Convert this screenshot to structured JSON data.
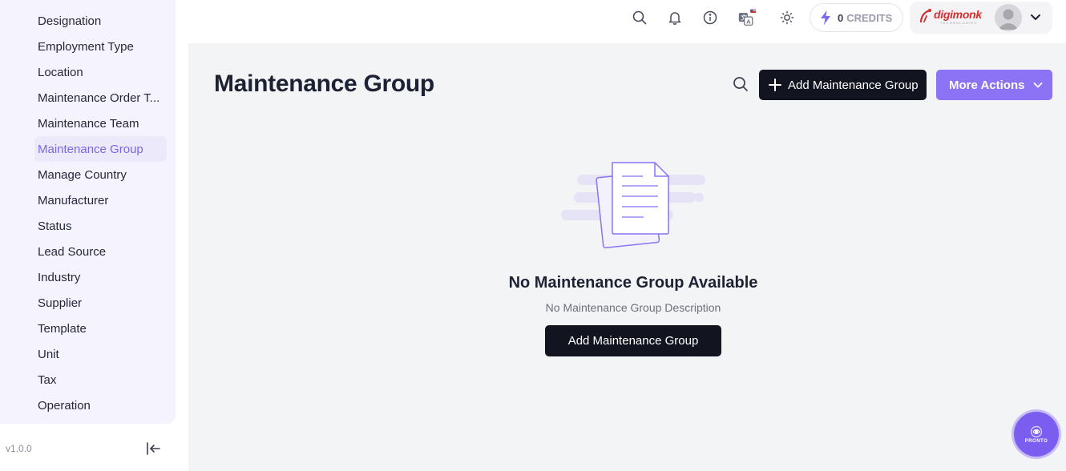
{
  "sidebar": {
    "items": [
      {
        "label": "Designation",
        "active": false
      },
      {
        "label": "Employment Type",
        "active": false
      },
      {
        "label": "Location",
        "active": false
      },
      {
        "label": "Maintenance Order T...",
        "active": false
      },
      {
        "label": "Maintenance Team",
        "active": false
      },
      {
        "label": "Maintenance Group",
        "active": true
      },
      {
        "label": "Manage Country",
        "active": false
      },
      {
        "label": "Manufacturer",
        "active": false
      },
      {
        "label": "Status",
        "active": false
      },
      {
        "label": "Lead Source",
        "active": false
      },
      {
        "label": "Industry",
        "active": false
      },
      {
        "label": "Supplier",
        "active": false
      },
      {
        "label": "Template",
        "active": false
      },
      {
        "label": "Unit",
        "active": false
      },
      {
        "label": "Tax",
        "active": false
      },
      {
        "label": "Operation",
        "active": false
      }
    ],
    "version": "v1.0.0",
    "collapse_icon": "collapse-left-icon"
  },
  "topbar": {
    "icons": [
      "search-icon",
      "bell-icon",
      "info-icon",
      "translate-icon",
      "theme-sun-icon"
    ],
    "credits": {
      "count": "0",
      "label": "CREDITS",
      "icon": "lightning-icon"
    },
    "profile": {
      "logo_text": "digimonk",
      "logo_sub": "TECHNOLOGIES",
      "dropdown_icon": "chevron-down-icon"
    }
  },
  "main": {
    "title": "Maintenance Group",
    "search_icon": "search-icon",
    "add_button": "Add Maintenance Group",
    "more_actions": "More Actions",
    "empty": {
      "title": "No Maintenance Group Available",
      "description": "No Maintenance Group Description",
      "button": "Add Maintenance Group"
    }
  },
  "assistant": {
    "label": "PRONTO"
  },
  "colors": {
    "accent": "#8c72f4",
    "active_text": "#7a68e8",
    "dark_button": "#121420",
    "sidebar_bg": "#f5f3fd",
    "main_bg": "#f3f4f6"
  }
}
